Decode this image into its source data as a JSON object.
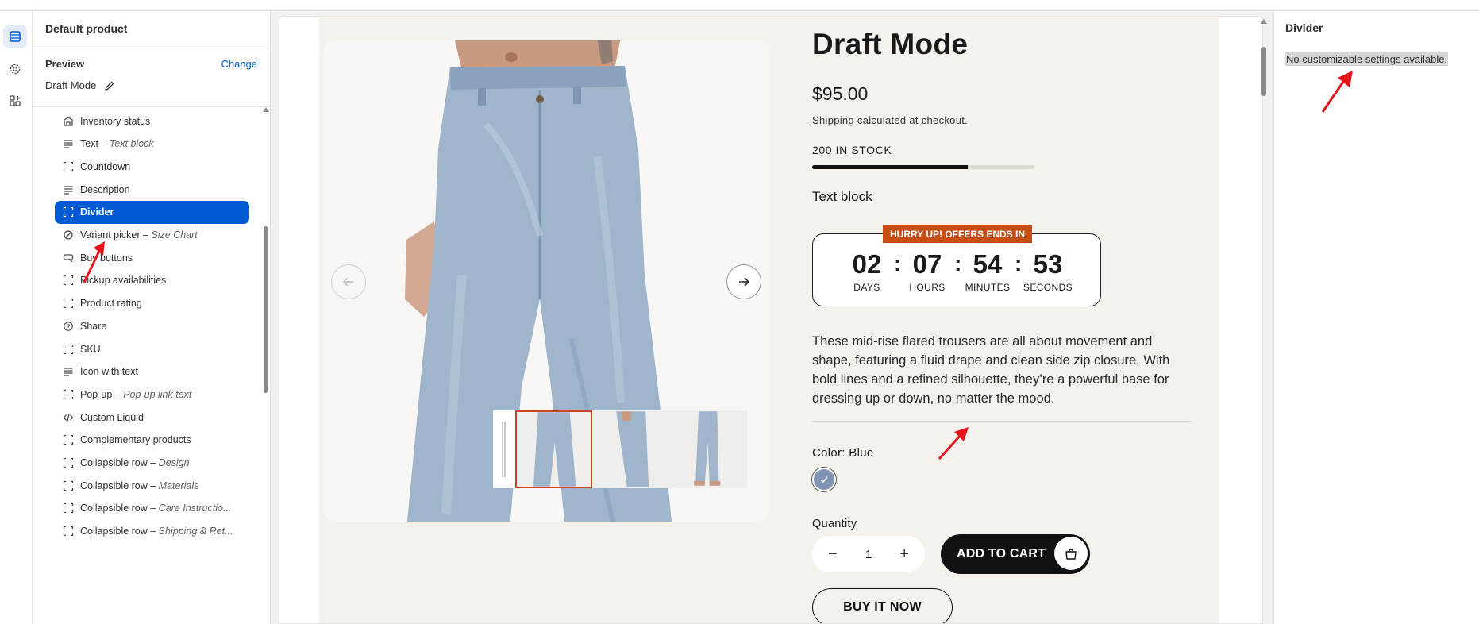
{
  "sidebar": {
    "title": "Default product",
    "preview_label": "Preview",
    "change_label": "Change",
    "preview_value": "Draft Mode",
    "items": [
      {
        "label": "Inventory status",
        "sub": "",
        "icon": "inventory-icon"
      },
      {
        "label": "Text",
        "sub": "Text block",
        "icon": "text-lines-icon"
      },
      {
        "label": "Countdown",
        "sub": "",
        "icon": "block-frame-icon"
      },
      {
        "label": "Description",
        "sub": "",
        "icon": "text-lines-icon"
      },
      {
        "label": "Divider",
        "sub": "",
        "icon": "block-frame-icon"
      },
      {
        "label": "Variant picker",
        "sub": "Size Chart",
        "icon": "variant-icon"
      },
      {
        "label": "Buy buttons",
        "sub": "",
        "icon": "buy-button-icon"
      },
      {
        "label": "Pickup availabilities",
        "sub": "",
        "icon": "block-frame-icon"
      },
      {
        "label": "Product rating",
        "sub": "",
        "icon": "block-frame-icon"
      },
      {
        "label": "Share",
        "sub": "",
        "icon": "share-icon"
      },
      {
        "label": "SKU",
        "sub": "",
        "icon": "block-frame-icon"
      },
      {
        "label": "Icon with text",
        "sub": "",
        "icon": "text-lines-icon"
      },
      {
        "label": "Pop-up",
        "sub": "Pop-up link text",
        "icon": "block-frame-icon"
      },
      {
        "label": "Custom Liquid",
        "sub": "",
        "icon": "code-icon"
      },
      {
        "label": "Complementary products",
        "sub": "",
        "icon": "block-frame-icon"
      },
      {
        "label": "Collapsible row",
        "sub": "Design",
        "icon": "block-frame-icon"
      },
      {
        "label": "Collapsible row",
        "sub": "Materials",
        "icon": "block-frame-icon"
      },
      {
        "label": "Collapsible row",
        "sub": "Care Instructio...",
        "icon": "block-frame-icon"
      },
      {
        "label": "Collapsible row",
        "sub": "Shipping & Ret...",
        "icon": "block-frame-icon"
      }
    ],
    "selected_index": 4
  },
  "product": {
    "title": "Draft Mode",
    "price": "$95.00",
    "shipping_link": "Shipping",
    "shipping_text": " calculated at checkout.",
    "stock_text": "200 IN STOCK",
    "stock_level": 0.7,
    "text_block": "Text block",
    "countdown": {
      "badge": "HURRY UP! OFFERS ENDS IN",
      "days": "02",
      "hours": "07",
      "minutes": "54",
      "seconds": "53",
      "days_label": "DAYS",
      "hours_label": "HOURS",
      "minutes_label": "MINUTES",
      "seconds_label": "SECONDS",
      "sep": ":"
    },
    "description": "These mid-rise flared trousers are all about movement and shape, featuring a fluid drape and clean side zip closure. With bold lines and a refined silhouette, they’re a powerful base for dressing up or down, no matter the mood.",
    "color_label": "Color: Blue",
    "swatch_color": "#7f95b3",
    "quantity_label": "Quantity",
    "quantity_value": "1",
    "minus": "−",
    "plus": "+",
    "add_to_cart": "ADD TO CART",
    "buy_now": "BUY IT NOW"
  },
  "right_panel": {
    "title": "Divider",
    "message": "No customizable settings available."
  },
  "colors": {
    "accent": "#005bd3",
    "badge": "#c84d15",
    "page_bg": "#f5f2ee",
    "annotation": "#e8121b"
  }
}
